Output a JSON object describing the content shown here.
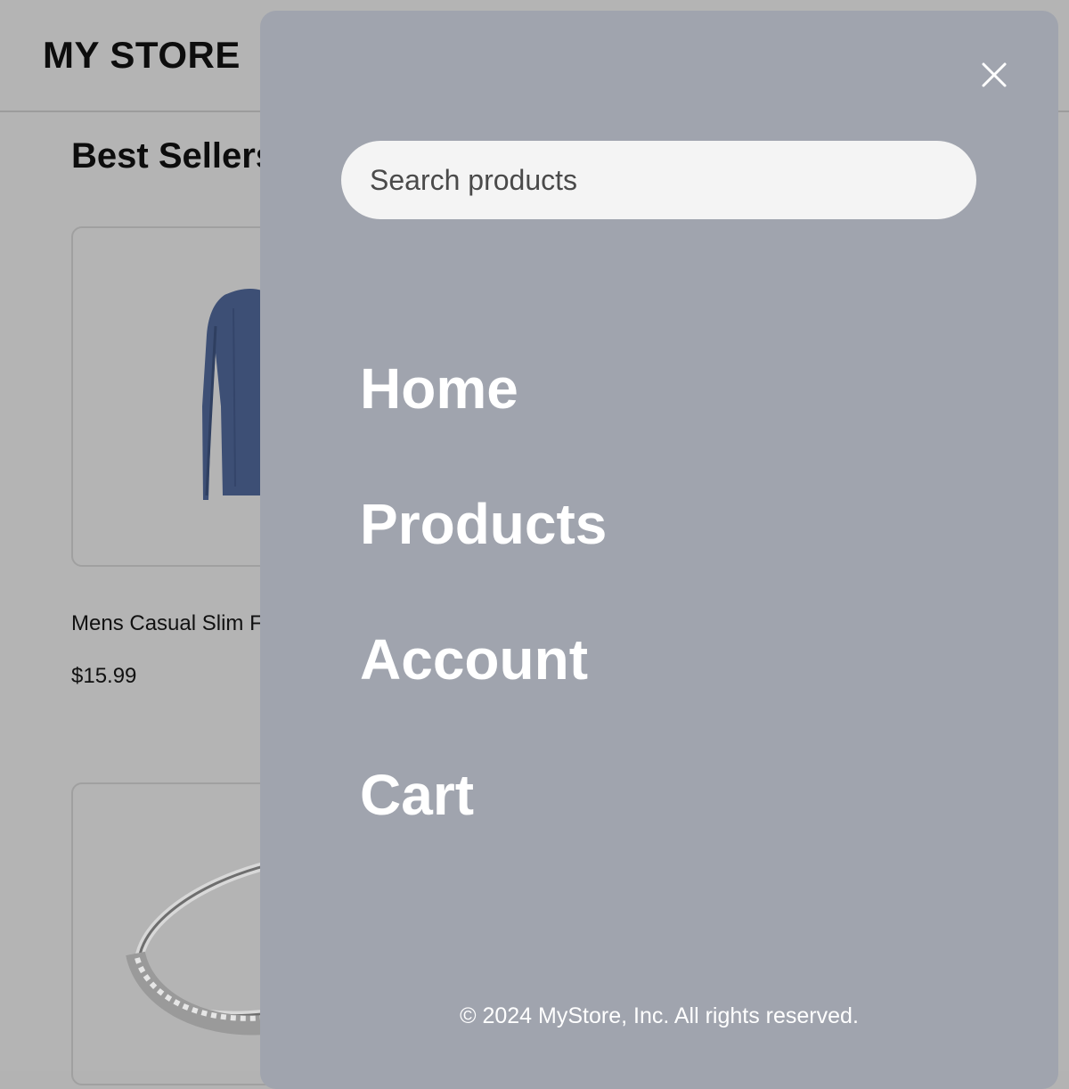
{
  "store": {
    "name": "MY STORE"
  },
  "best_sellers": {
    "title": "Best Sellers",
    "products": [
      {
        "name": "Mens Casual Slim Fit",
        "price": "$15.99"
      }
    ]
  },
  "menu": {
    "search": {
      "placeholder": "Search products",
      "value": ""
    },
    "nav_items": [
      {
        "label": "Home"
      },
      {
        "label": "Products"
      },
      {
        "label": "Account"
      },
      {
        "label": "Cart"
      }
    ],
    "footer": "© 2024 MyStore, Inc. All rights reserved."
  },
  "icons": {
    "close": "close-icon"
  },
  "colors": {
    "overlay_panel": "#a0a4ae",
    "background_dim": "#b4b4b4",
    "search_bg": "#f4f4f4",
    "nav_text": "#ffffff",
    "shirt": "#3d4f75"
  }
}
